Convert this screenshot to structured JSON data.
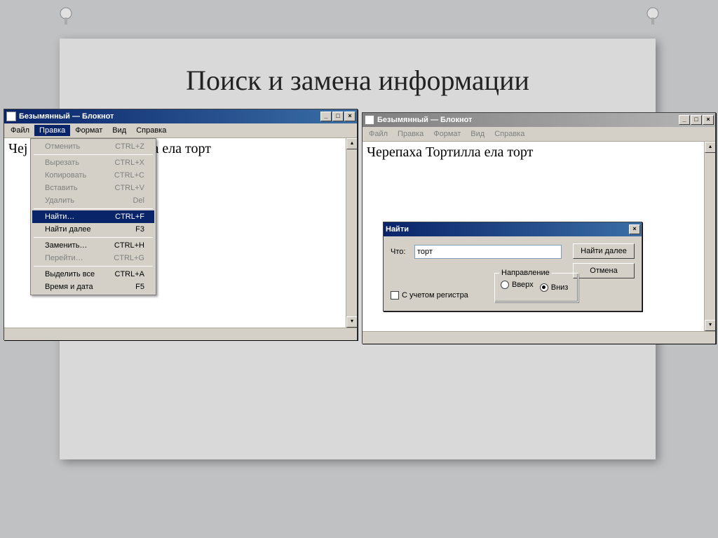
{
  "slide": {
    "title": "Поиск и замена информации"
  },
  "notepad_left": {
    "title": "Безымянный — Блокнот",
    "menus": [
      "Файл",
      "Правка",
      "Формат",
      "Вид",
      "Справка"
    ],
    "open_menu_index": 1,
    "text_visible_left": "Чеј",
    "text_visible_right": "а ела торт",
    "dropdown": [
      {
        "label": "Отменить",
        "shortcut": "CTRL+Z",
        "enabled": false
      },
      "sep",
      {
        "label": "Вырезать",
        "shortcut": "CTRL+X",
        "enabled": false
      },
      {
        "label": "Копировать",
        "shortcut": "CTRL+C",
        "enabled": false
      },
      {
        "label": "Вставить",
        "shortcut": "CTRL+V",
        "enabled": false
      },
      {
        "label": "Удалить",
        "shortcut": "Del",
        "enabled": false
      },
      "sep",
      {
        "label": "Найти…",
        "shortcut": "CTRL+F",
        "enabled": true,
        "highlight": true
      },
      {
        "label": "Найти далее",
        "shortcut": "F3",
        "enabled": true
      },
      "sep",
      {
        "label": "Заменить…",
        "shortcut": "CTRL+H",
        "enabled": true
      },
      {
        "label": "Перейти…",
        "shortcut": "CTRL+G",
        "enabled": false
      },
      "sep",
      {
        "label": "Выделить все",
        "shortcut": "CTRL+A",
        "enabled": true
      },
      {
        "label": "Время и дата",
        "shortcut": "F5",
        "enabled": true
      }
    ]
  },
  "notepad_right": {
    "title": "Безымянный — Блокнот",
    "menus": [
      "Файл",
      "Правка",
      "Формат",
      "Вид",
      "Справка"
    ],
    "text": "Черепаха Тортилла ела торт"
  },
  "find_dialog": {
    "title": "Найти",
    "what_label": "Что:",
    "what_value": "торт",
    "find_next": "Найти далее",
    "cancel": "Отмена",
    "case_label": "С учетом регистра",
    "direction_legend": "Направление",
    "dir_up": "Вверх",
    "dir_down": "Вниз",
    "dir_selected": "down"
  }
}
